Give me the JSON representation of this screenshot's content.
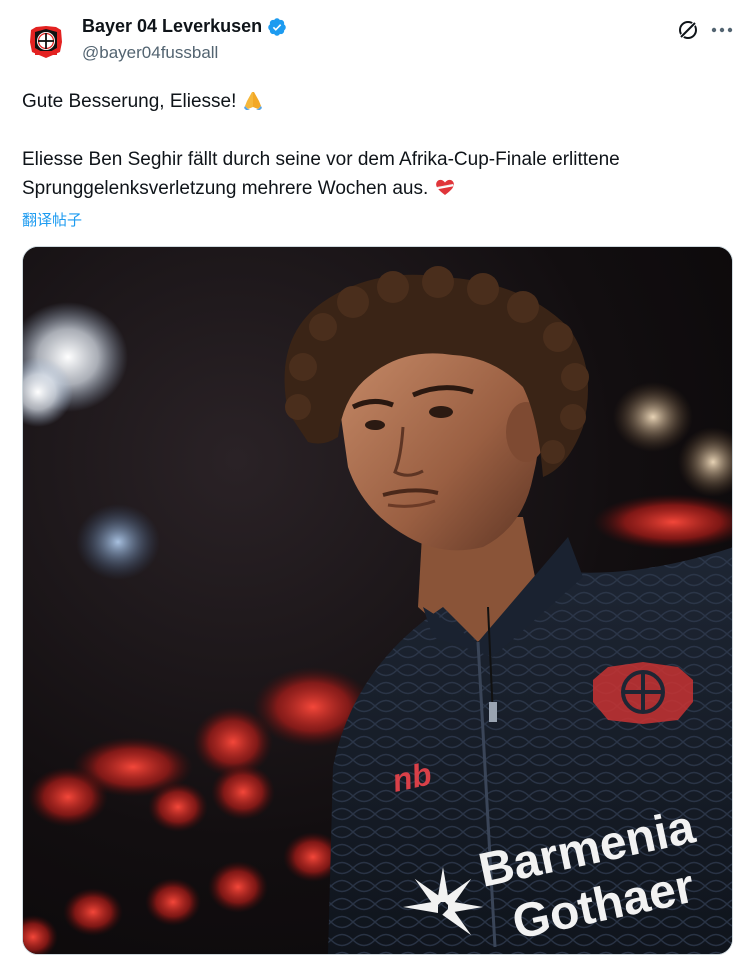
{
  "author": {
    "display_name": "Bayer 04 Leverkusen",
    "handle": "@bayer04fussball",
    "verified": true,
    "avatar_icon": "bayer-cross-logo"
  },
  "header_actions": {
    "grok_icon": "grok-icon",
    "more_icon": "more-icon"
  },
  "tweet": {
    "line1": "Gute Besserung, Eliesse!",
    "line1_emoji": "folded-hands",
    "line2": "Eliesse Ben Seghir fällt durch seine vor dem Afrika-Cup-Finale erlittene",
    "line3": "Sprunggelenksverletzung mehrere Wochen aus.",
    "line3_emoji": "mending-heart"
  },
  "translate_label": "翻译帖子",
  "media": {
    "jersey_sponsor_line1": "Barmenia",
    "jersey_sponsor_line2": "Gothaer"
  },
  "colors": {
    "link": "#1d9bf0",
    "verified": "#1d9bf0",
    "muted": "#536471",
    "brand_red": "#e32221"
  }
}
